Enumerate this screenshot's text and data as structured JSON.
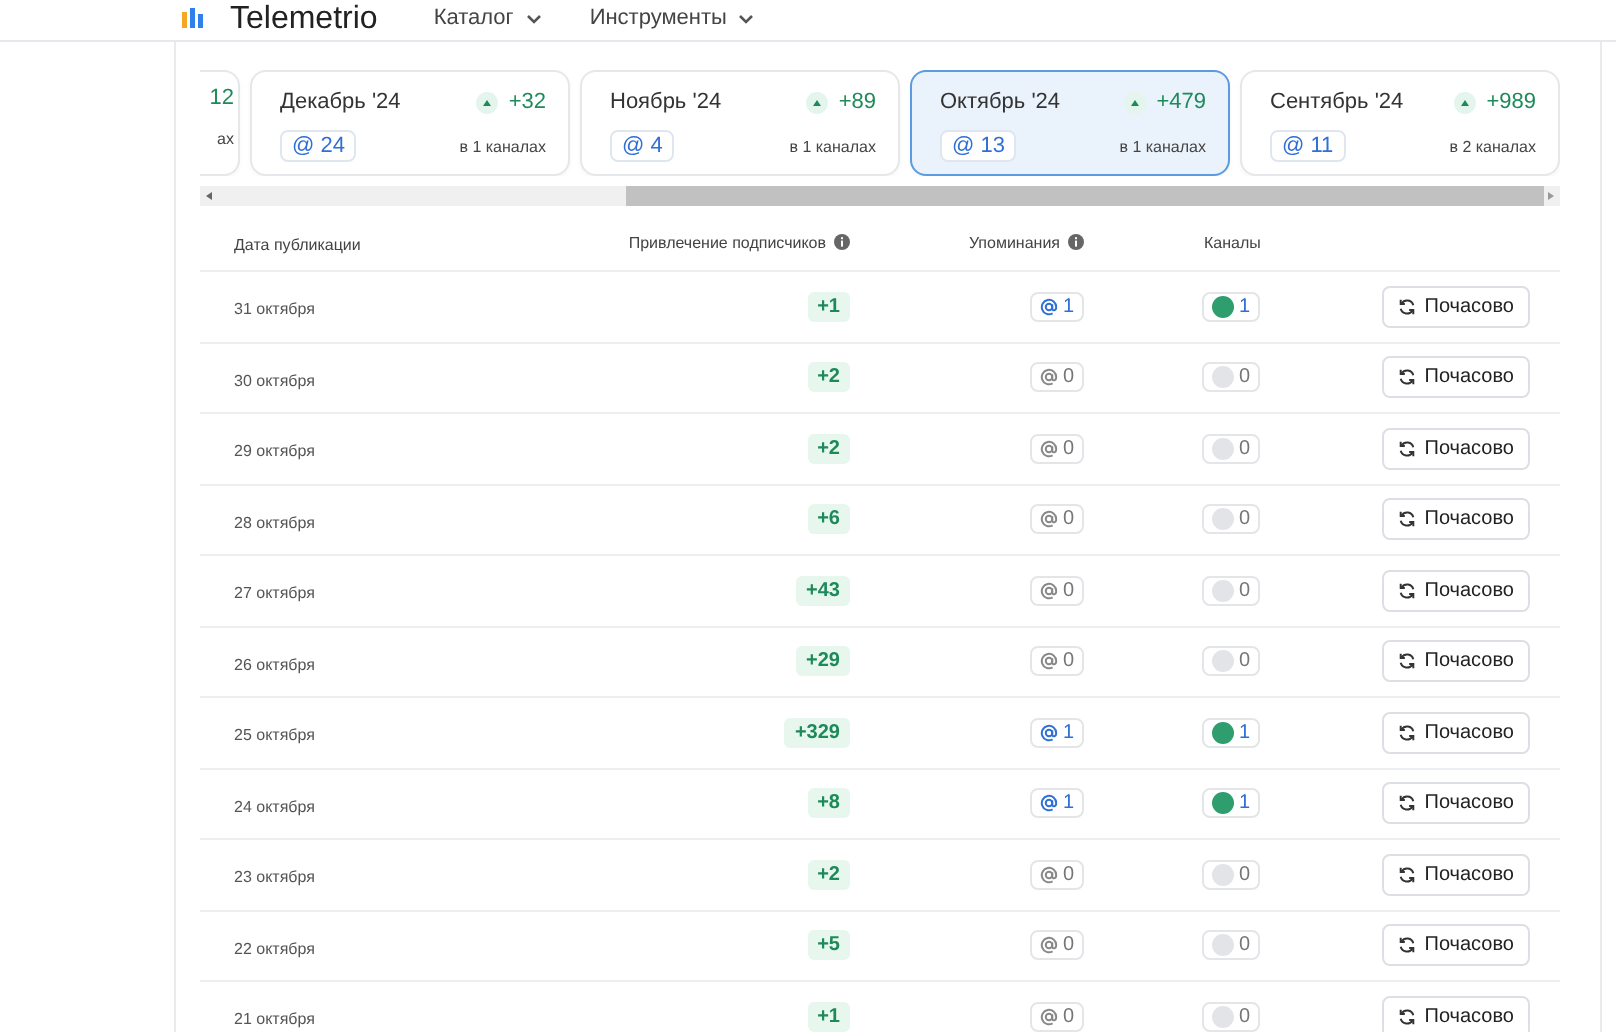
{
  "header": {
    "brand": "Telemetrio",
    "menu": [
      {
        "label": "Каталог"
      },
      {
        "label": "Инструменты"
      }
    ]
  },
  "months": [
    {
      "kind": "partial",
      "growth": "12",
      "channels": "ах",
      "selected": false
    },
    {
      "kind": "full",
      "title": "Декабрь '24",
      "growth": "+32",
      "mentions": "@ 24",
      "channels": "в 1 каналах",
      "selected": false
    },
    {
      "kind": "full",
      "title": "Ноябрь '24",
      "growth": "+89",
      "mentions": "@ 4",
      "channels": "в 1 каналах",
      "selected": false
    },
    {
      "kind": "full",
      "title": "Октябрь '24",
      "growth": "+479",
      "mentions": "@ 13",
      "channels": "в 1 каналах",
      "selected": true
    },
    {
      "kind": "full",
      "title": "Сентябрь '24",
      "growth": "+989",
      "mentions": "@ 11",
      "channels": "в 2 каналах",
      "selected": false
    }
  ],
  "table": {
    "columns": [
      "Дата публикации",
      "Привлечение подписчиков",
      "Упоминания",
      "Каналы"
    ],
    "rows": [
      {
        "date": "31 октября",
        "growth": "+1",
        "mentions": "1",
        "mentions_active": true,
        "channels": "1",
        "channels_active": true,
        "button": "Почасово"
      },
      {
        "date": "30 октября",
        "growth": "+2",
        "mentions": "0",
        "mentions_active": false,
        "channels": "0",
        "channels_active": false,
        "button": "Почасово"
      },
      {
        "date": "29 октября",
        "growth": "+2",
        "mentions": "0",
        "mentions_active": false,
        "channels": "0",
        "channels_active": false,
        "button": "Почасово"
      },
      {
        "date": "28 октября",
        "growth": "+6",
        "mentions": "0",
        "mentions_active": false,
        "channels": "0",
        "channels_active": false,
        "button": "Почасово"
      },
      {
        "date": "27 октября",
        "growth": "+43",
        "mentions": "0",
        "mentions_active": false,
        "channels": "0",
        "channels_active": false,
        "button": "Почасово"
      },
      {
        "date": "26 октября",
        "growth": "+29",
        "mentions": "0",
        "mentions_active": false,
        "channels": "0",
        "channels_active": false,
        "button": "Почасово"
      },
      {
        "date": "25 октября",
        "growth": "+329",
        "mentions": "1",
        "mentions_active": true,
        "channels": "1",
        "channels_active": true,
        "button": "Почасово"
      },
      {
        "date": "24 октября",
        "growth": "+8",
        "mentions": "1",
        "mentions_active": true,
        "channels": "1",
        "channels_active": true,
        "button": "Почасово"
      },
      {
        "date": "23 октября",
        "growth": "+2",
        "mentions": "0",
        "mentions_active": false,
        "channels": "0",
        "channels_active": false,
        "button": "Почасово"
      },
      {
        "date": "22 октября",
        "growth": "+5",
        "mentions": "0",
        "mentions_active": false,
        "channels": "0",
        "channels_active": false,
        "button": "Почасово"
      },
      {
        "date": "21 октября",
        "growth": "+1",
        "mentions": "0",
        "mentions_active": false,
        "channels": "0",
        "channels_active": false,
        "button": "Почасово"
      }
    ]
  }
}
